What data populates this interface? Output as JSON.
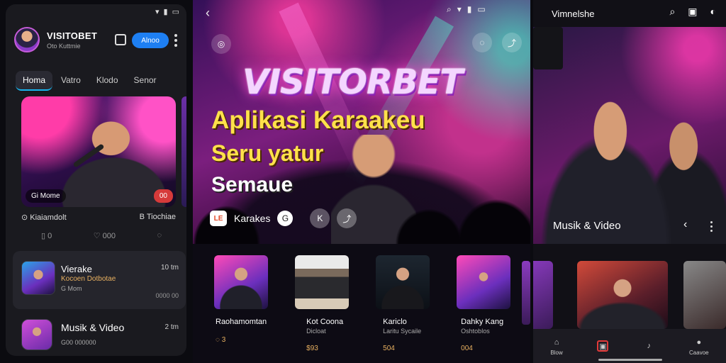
{
  "panel_a": {
    "status_icons": [
      "wifi-icon",
      "signal-icon",
      "battery-icon"
    ],
    "profile": {
      "name": "VISITOBET",
      "subtitle": "Oto Kuttmie"
    },
    "action_label": "Alnoo",
    "tabs": [
      "Homa",
      "Vatro",
      "Klodo",
      "Senor"
    ],
    "hero": {
      "label": "Gi Mome",
      "badge": "00"
    },
    "location": {
      "left": "Kiaiamdolt",
      "right": "B Tiochiae"
    },
    "stats": [
      "0",
      "000",
      ""
    ],
    "list": [
      {
        "title": "Vierake",
        "sub": "Kocoen Dotbotae",
        "meta": "G Mom",
        "time": "10 tm",
        "count": "0000 00"
      },
      {
        "title": "Musik & Video",
        "meta": "G00 000000",
        "time": "2 tm",
        "count": ""
      }
    ]
  },
  "panel_b": {
    "status_icons": [
      "search-icon",
      "wifi-icon",
      "signal-icon",
      "battery-icon"
    ],
    "brand": "VISITORBET",
    "headline1": "Aplikasi Karaakeu",
    "headline2": "Seru yatur",
    "headline3": "Semaue",
    "karaoke_label": "Karakes",
    "thumbs": [
      {
        "title": "Raohamomtan",
        "sub": "",
        "price": "3"
      },
      {
        "title": "Kot Coona",
        "sub": "Dicloat",
        "price": "$93"
      },
      {
        "title": "Kariclo",
        "sub": "Laritu Sycaile",
        "price": "504"
      },
      {
        "title": "Dahky Kang",
        "sub": "Oshtoblos",
        "price": "004"
      }
    ]
  },
  "panel_c": {
    "title": "Vimnelshe",
    "status_icons": [
      "search-icon",
      "cast-icon",
      "toggle-icon"
    ],
    "section_label": "Musik & Video",
    "bottom_nav": [
      "Blow",
      "",
      "",
      "Caavoe"
    ]
  },
  "colors": {
    "accent_blue": "#1e7ff2",
    "accent_gold": "#ffe14a",
    "badge_red": "#d63a3a",
    "tab_underline": "#18b6f0"
  }
}
